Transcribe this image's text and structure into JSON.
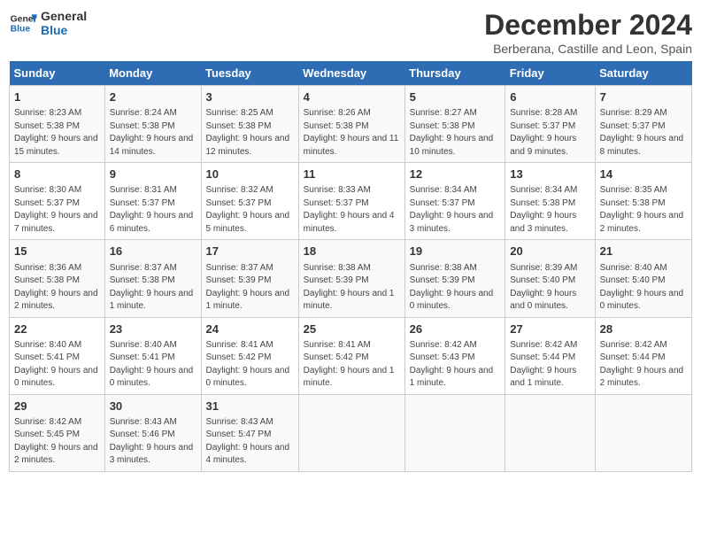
{
  "header": {
    "logo_line1": "General",
    "logo_line2": "Blue",
    "title": "December 2024",
    "subtitle": "Berberana, Castille and Leon, Spain"
  },
  "days_of_week": [
    "Sunday",
    "Monday",
    "Tuesday",
    "Wednesday",
    "Thursday",
    "Friday",
    "Saturday"
  ],
  "weeks": [
    [
      {
        "day": "1",
        "info": "Sunrise: 8:23 AM\nSunset: 5:38 PM\nDaylight: 9 hours and 15 minutes."
      },
      {
        "day": "2",
        "info": "Sunrise: 8:24 AM\nSunset: 5:38 PM\nDaylight: 9 hours and 14 minutes."
      },
      {
        "day": "3",
        "info": "Sunrise: 8:25 AM\nSunset: 5:38 PM\nDaylight: 9 hours and 12 minutes."
      },
      {
        "day": "4",
        "info": "Sunrise: 8:26 AM\nSunset: 5:38 PM\nDaylight: 9 hours and 11 minutes."
      },
      {
        "day": "5",
        "info": "Sunrise: 8:27 AM\nSunset: 5:38 PM\nDaylight: 9 hours and 10 minutes."
      },
      {
        "day": "6",
        "info": "Sunrise: 8:28 AM\nSunset: 5:37 PM\nDaylight: 9 hours and 9 minutes."
      },
      {
        "day": "7",
        "info": "Sunrise: 8:29 AM\nSunset: 5:37 PM\nDaylight: 9 hours and 8 minutes."
      }
    ],
    [
      {
        "day": "8",
        "info": "Sunrise: 8:30 AM\nSunset: 5:37 PM\nDaylight: 9 hours and 7 minutes."
      },
      {
        "day": "9",
        "info": "Sunrise: 8:31 AM\nSunset: 5:37 PM\nDaylight: 9 hours and 6 minutes."
      },
      {
        "day": "10",
        "info": "Sunrise: 8:32 AM\nSunset: 5:37 PM\nDaylight: 9 hours and 5 minutes."
      },
      {
        "day": "11",
        "info": "Sunrise: 8:33 AM\nSunset: 5:37 PM\nDaylight: 9 hours and 4 minutes."
      },
      {
        "day": "12",
        "info": "Sunrise: 8:34 AM\nSunset: 5:37 PM\nDaylight: 9 hours and 3 minutes."
      },
      {
        "day": "13",
        "info": "Sunrise: 8:34 AM\nSunset: 5:38 PM\nDaylight: 9 hours and 3 minutes."
      },
      {
        "day": "14",
        "info": "Sunrise: 8:35 AM\nSunset: 5:38 PM\nDaylight: 9 hours and 2 minutes."
      }
    ],
    [
      {
        "day": "15",
        "info": "Sunrise: 8:36 AM\nSunset: 5:38 PM\nDaylight: 9 hours and 2 minutes."
      },
      {
        "day": "16",
        "info": "Sunrise: 8:37 AM\nSunset: 5:38 PM\nDaylight: 9 hours and 1 minute."
      },
      {
        "day": "17",
        "info": "Sunrise: 8:37 AM\nSunset: 5:39 PM\nDaylight: 9 hours and 1 minute."
      },
      {
        "day": "18",
        "info": "Sunrise: 8:38 AM\nSunset: 5:39 PM\nDaylight: 9 hours and 1 minute."
      },
      {
        "day": "19",
        "info": "Sunrise: 8:38 AM\nSunset: 5:39 PM\nDaylight: 9 hours and 0 minutes."
      },
      {
        "day": "20",
        "info": "Sunrise: 8:39 AM\nSunset: 5:40 PM\nDaylight: 9 hours and 0 minutes."
      },
      {
        "day": "21",
        "info": "Sunrise: 8:40 AM\nSunset: 5:40 PM\nDaylight: 9 hours and 0 minutes."
      }
    ],
    [
      {
        "day": "22",
        "info": "Sunrise: 8:40 AM\nSunset: 5:41 PM\nDaylight: 9 hours and 0 minutes."
      },
      {
        "day": "23",
        "info": "Sunrise: 8:40 AM\nSunset: 5:41 PM\nDaylight: 9 hours and 0 minutes."
      },
      {
        "day": "24",
        "info": "Sunrise: 8:41 AM\nSunset: 5:42 PM\nDaylight: 9 hours and 0 minutes."
      },
      {
        "day": "25",
        "info": "Sunrise: 8:41 AM\nSunset: 5:42 PM\nDaylight: 9 hours and 1 minute."
      },
      {
        "day": "26",
        "info": "Sunrise: 8:42 AM\nSunset: 5:43 PM\nDaylight: 9 hours and 1 minute."
      },
      {
        "day": "27",
        "info": "Sunrise: 8:42 AM\nSunset: 5:44 PM\nDaylight: 9 hours and 1 minute."
      },
      {
        "day": "28",
        "info": "Sunrise: 8:42 AM\nSunset: 5:44 PM\nDaylight: 9 hours and 2 minutes."
      }
    ],
    [
      {
        "day": "29",
        "info": "Sunrise: 8:42 AM\nSunset: 5:45 PM\nDaylight: 9 hours and 2 minutes."
      },
      {
        "day": "30",
        "info": "Sunrise: 8:43 AM\nSunset: 5:46 PM\nDaylight: 9 hours and 3 minutes."
      },
      {
        "day": "31",
        "info": "Sunrise: 8:43 AM\nSunset: 5:47 PM\nDaylight: 9 hours and 4 minutes."
      },
      {
        "day": "",
        "info": ""
      },
      {
        "day": "",
        "info": ""
      },
      {
        "day": "",
        "info": ""
      },
      {
        "day": "",
        "info": ""
      }
    ]
  ]
}
